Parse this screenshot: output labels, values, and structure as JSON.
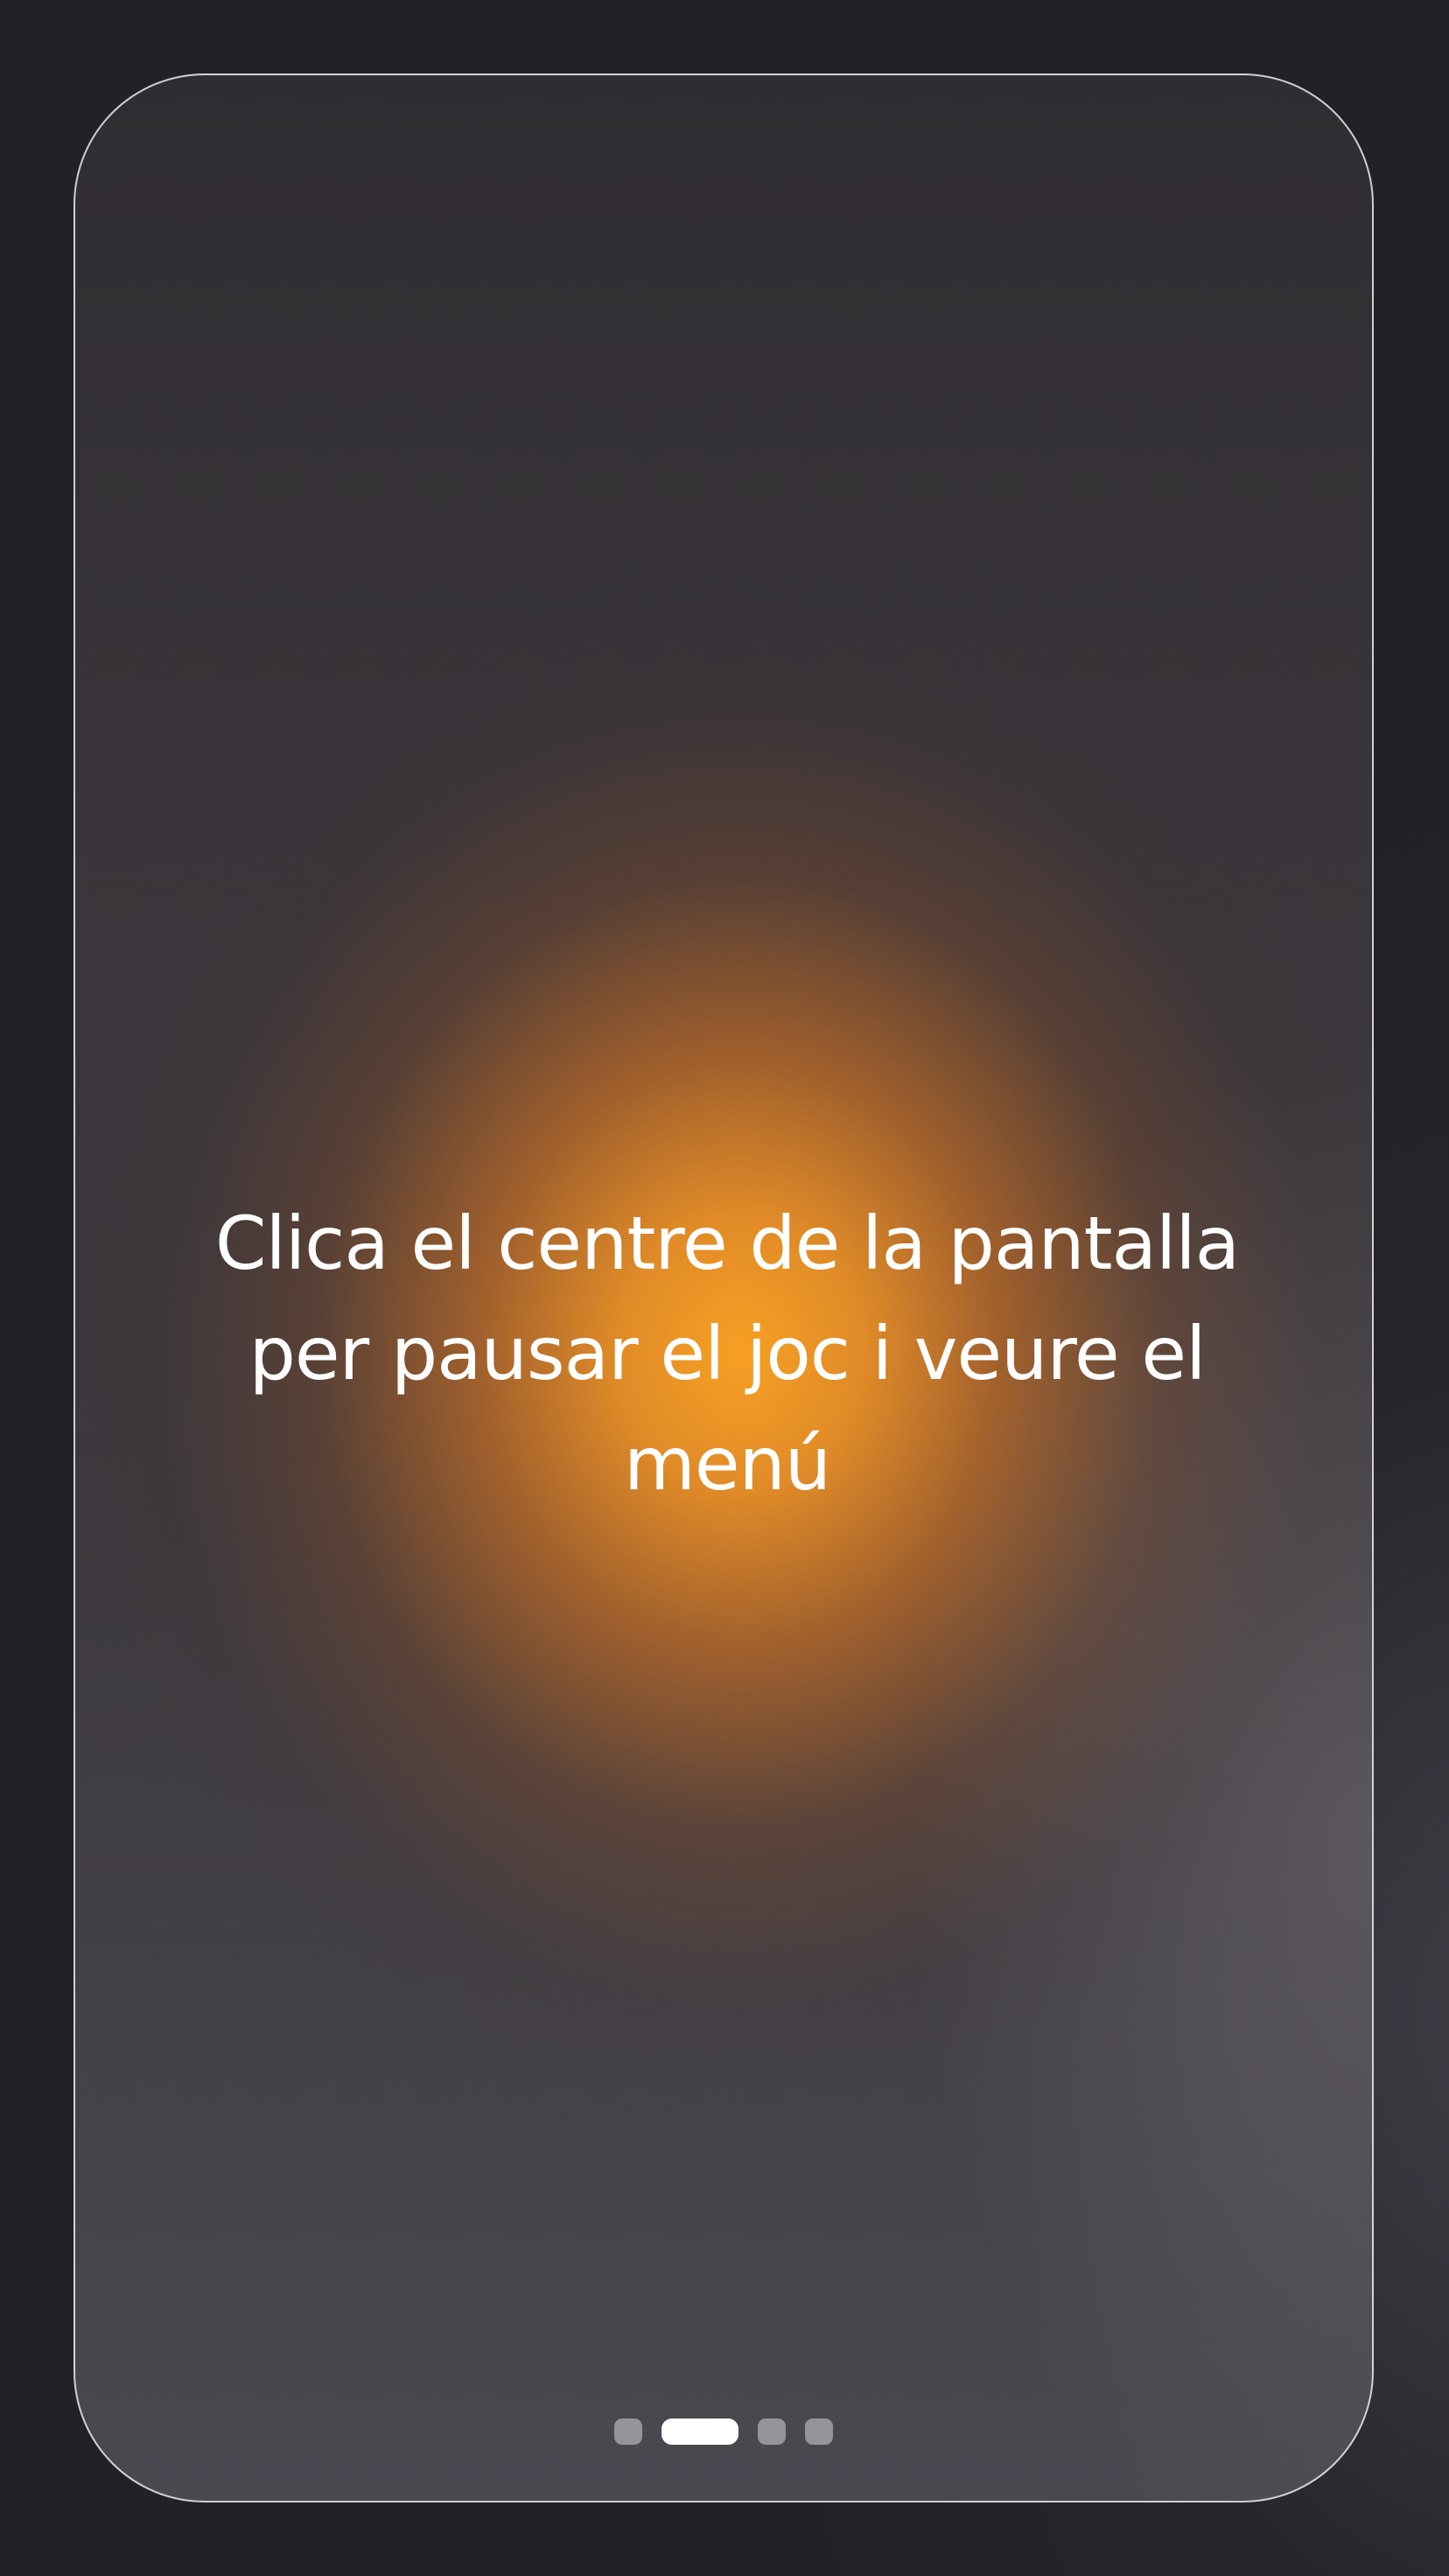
{
  "onboarding": {
    "message": "Clica el centre de la pantalla per pausar el joc i veure el menú",
    "page_indicator": {
      "total": 4,
      "active_index": 1
    }
  },
  "colors": {
    "background": "#222127",
    "glow": "#F7A023",
    "card_border": "#EBEBF0",
    "text": "#FFFFFF",
    "dot_active": "#FFFFFF",
    "dot_inactive": "#8E8D93"
  }
}
